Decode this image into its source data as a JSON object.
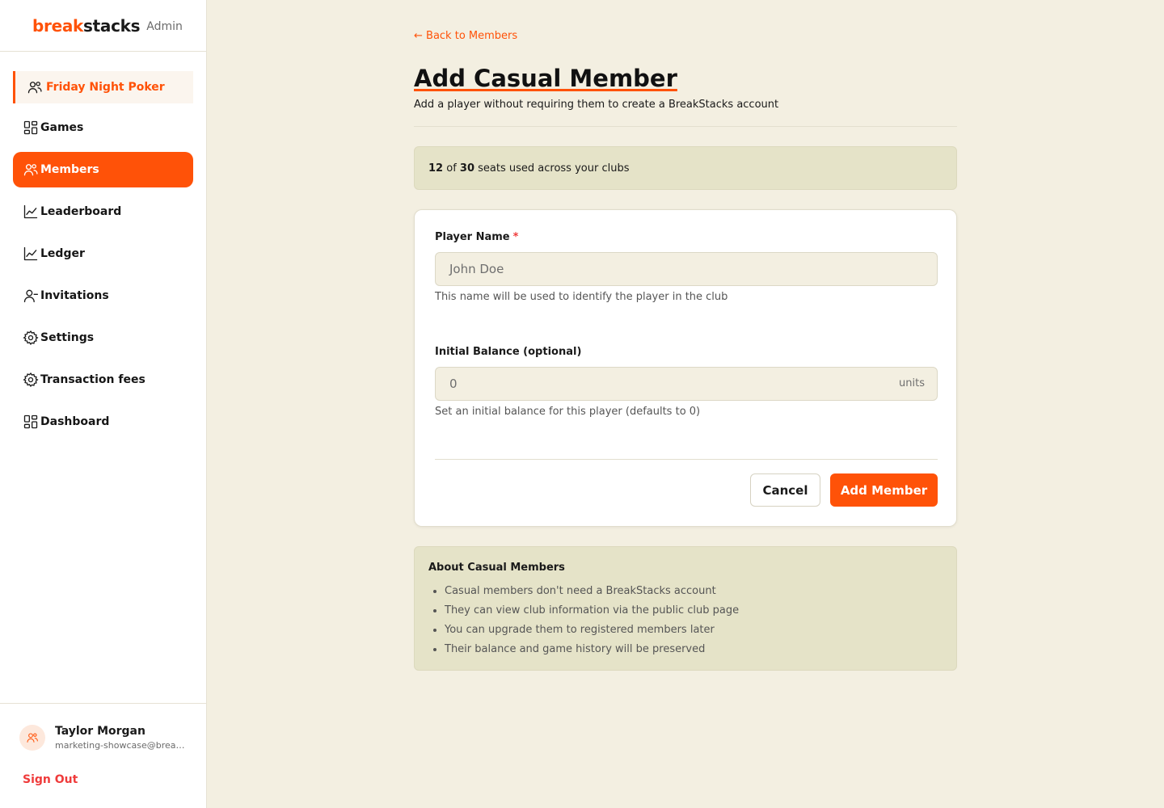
{
  "brand": {
    "part1": "break",
    "part2": "stacks",
    "suffix": "Admin"
  },
  "club": {
    "name": "Friday Night Poker",
    "icon": "users-icon"
  },
  "nav": [
    {
      "label": "Games",
      "icon": "grid-icon"
    },
    {
      "label": "Members",
      "icon": "users-icon",
      "active": true
    },
    {
      "label": "Leaderboard",
      "icon": "chart-line-icon"
    },
    {
      "label": "Ledger",
      "icon": "chart-line-icon"
    },
    {
      "label": "Invitations",
      "icon": "user-icon"
    },
    {
      "label": "Settings",
      "icon": "gear-icon"
    },
    {
      "label": "Transaction fees",
      "icon": "gear-icon"
    },
    {
      "label": "Dashboard",
      "icon": "grid-icon"
    }
  ],
  "user": {
    "name": "Taylor Morgan",
    "email": "marketing-showcase@breakstacks.com",
    "signout": "Sign Out"
  },
  "page": {
    "back": "← Back to Members",
    "title": "Add Casual Member",
    "subtitle": "Add a player without requiring them to create a BreakStacks account"
  },
  "seats": {
    "used": "12",
    "of": "of",
    "total": "30",
    "suffix": "seats used across your clubs"
  },
  "form": {
    "name_label": "Player Name",
    "required_mark": "*",
    "name_placeholder": "John Doe",
    "name_help": "This name will be used to identify the player in the club",
    "balance_label": "Initial Balance (optional)",
    "balance_placeholder": "0",
    "balance_unit": "units",
    "balance_help": "Set an initial balance for this player (defaults to 0)",
    "cancel": "Cancel",
    "submit": "Add Member"
  },
  "about": {
    "title": "About Casual Members",
    "items": [
      "Casual members don't need a BreakStacks account",
      "They can view club information via the public club page",
      "You can upgrade them to registered members later",
      "Their balance and game history will be preserved"
    ]
  },
  "colors": {
    "accent": "#ff5208",
    "background": "#f3efe1",
    "info_box": "#e5e3c8",
    "danger": "#ef3b3b"
  }
}
